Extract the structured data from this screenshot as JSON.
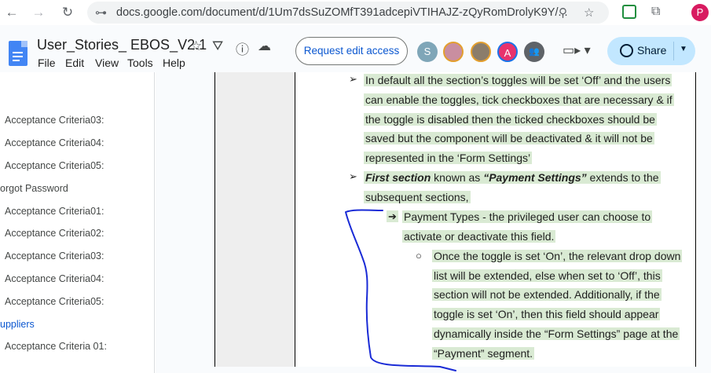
{
  "browser": {
    "url": "docs.google.com/document/d/1Um7dsSuZOMfT391adcepiVTIHAJZ-zQyRomDrolyK9Y/...",
    "profile_initial": "P"
  },
  "docs": {
    "title": "User_Stories_ EBOS_V2.1",
    "menu": [
      "File",
      "Edit",
      "View",
      "Tools",
      "Help"
    ],
    "request_button": "Request edit access",
    "share_label": "Share",
    "collaborators": [
      {
        "initial": "S",
        "color": "#7fa6b8"
      },
      {
        "initial": "",
        "color": "#c98ea0"
      },
      {
        "initial": "",
        "color": "#8b7d6b"
      },
      {
        "initial": "A",
        "color": "#e8336d"
      },
      {
        "initial": "",
        "color": "#5f6368"
      }
    ]
  },
  "outline": {
    "items": [
      {
        "label": "Acceptance Criteria03:",
        "level": 2
      },
      {
        "label": "Acceptance Criteria04:",
        "level": 2
      },
      {
        "label": "Acceptance Criteria05:",
        "level": 2
      },
      {
        "label": "orgot Password",
        "level": 1
      },
      {
        "label": "Acceptance Criteria01:",
        "level": 2
      },
      {
        "label": "Acceptance Criteria02:",
        "level": 2
      },
      {
        "label": "Acceptance Criteria03:",
        "level": 2
      },
      {
        "label": "Acceptance Criteria04:",
        "level": 2
      },
      {
        "label": "Acceptance Criteria05:",
        "level": 2
      },
      {
        "label": "uppliers",
        "level": 1,
        "active": true
      },
      {
        "label": "Acceptance Criteria 01:",
        "level": 2
      }
    ]
  },
  "content": {
    "p1": [
      "In default all the section’s toggles will be set ‘Off’ and the users",
      "can enable the toggles, tick checkboxes that are necessary & if",
      "the toggle is disabled then the ticked checkboxes should be",
      "saved but the component will be deactivated & it will not be",
      "represented in the ‘Form Settings’"
    ],
    "p2_bold1": "First section",
    "p2_mid": " known as ",
    "p2_bold2": "“Payment Settings”",
    "p2_tail": " extends to the",
    "p2_line2": "subsequent sections,",
    "p3": [
      "Payment Types - the privileged user can choose to",
      "activate or deactivate this field."
    ],
    "p4": [
      "Once the toggle is set ‘On’, the relevant drop down",
      "list will be extended, else when set to ‘Off’, this",
      "section will not be extended. Additionally, if the",
      "toggle is set ‘On’, then this field should appear",
      "dynamically inside the “Form Settings” page at the",
      "“Payment” segment."
    ],
    "bullet_arrow": "➢",
    "bullet_right": "➔",
    "bullet_circle": "○"
  }
}
